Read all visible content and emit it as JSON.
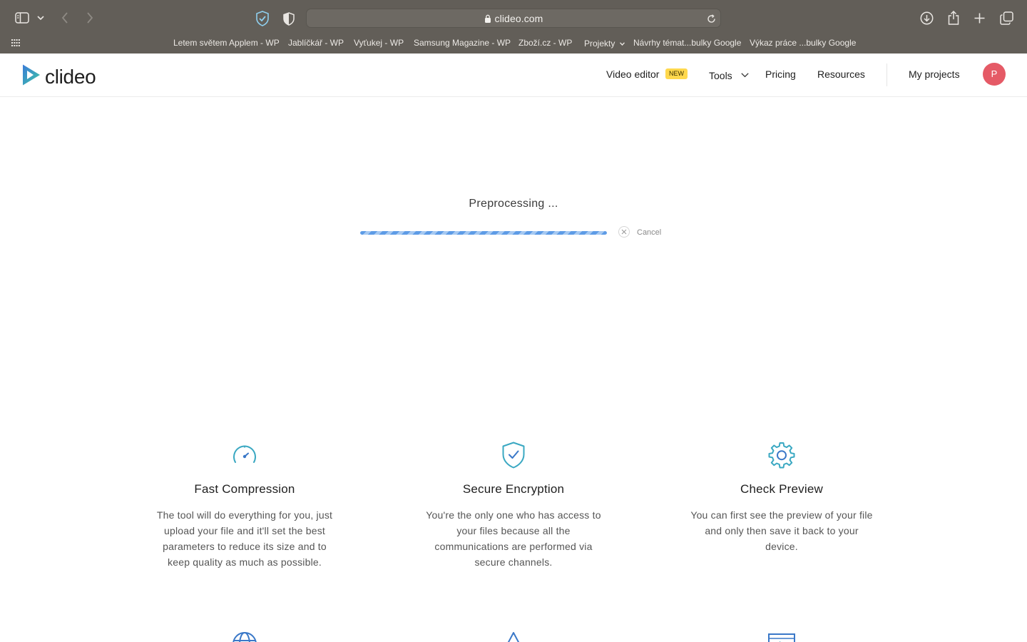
{
  "browser": {
    "url": "clideo.com",
    "bookmarks": [
      {
        "label": "Letem světem Applem - WP"
      },
      {
        "label": "Jablíčkář - WP"
      },
      {
        "label": "Vyťukej - WP"
      },
      {
        "label": "Samsung Magazine - WP"
      },
      {
        "label": "Zboží.cz - WP"
      },
      {
        "label": "Projekty"
      },
      {
        "label": "Návrhy témat...bulky Google"
      },
      {
        "label": "Výkaz práce ...bulky Google"
      }
    ]
  },
  "header": {
    "logo": "clideo",
    "nav": {
      "video_editor": "Video editor",
      "new_badge": "NEW",
      "tools": "Tools",
      "pricing": "Pricing",
      "resources": "Resources",
      "my_projects": "My projects"
    },
    "avatar_initial": "P"
  },
  "processing": {
    "status": "Preprocessing ...",
    "progress": 1.0,
    "cancel": "Cancel"
  },
  "features": [
    {
      "icon": "speedometer-icon",
      "title": "Fast Compression",
      "description": "The tool will do everything for you, just upload your file and it'll set the best parameters to reduce its size and to keep quality as much as possible."
    },
    {
      "icon": "shield-check-icon",
      "title": "Secure Encryption",
      "description": "You're the only one who has access to your files because all the communications are performed via secure channels."
    },
    {
      "icon": "gear-icon",
      "title": "Check Preview",
      "description": "You can first see the preview of your file and only then save it back to your device."
    }
  ],
  "colors": {
    "accent": "#5e9ce6",
    "icon_teal": "#3aa8c2",
    "avatar": "#e55a66",
    "badge": "#ffd84d",
    "browser_chrome": "#625e58"
  }
}
